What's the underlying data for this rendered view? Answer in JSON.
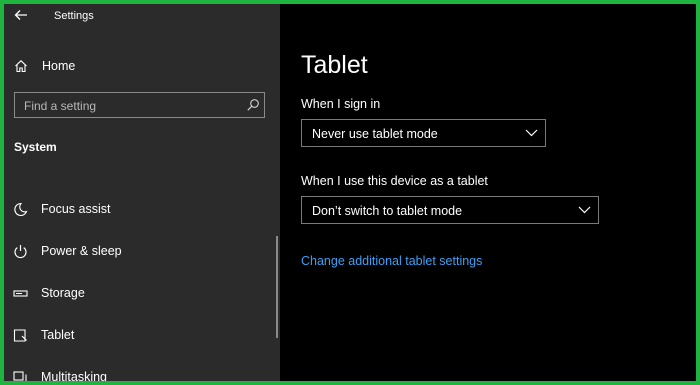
{
  "window": {
    "title": "Settings"
  },
  "sidebar": {
    "home_label": "Home",
    "search_placeholder": "Find a setting",
    "section_title": "System",
    "items": [
      {
        "label": "Focus assist",
        "icon": "moon-icon"
      },
      {
        "label": "Power & sleep",
        "icon": "power-icon"
      },
      {
        "label": "Storage",
        "icon": "storage-icon"
      },
      {
        "label": "Tablet",
        "icon": "tablet-icon"
      },
      {
        "label": "Multitasking",
        "icon": "multitasking-icon"
      }
    ]
  },
  "main": {
    "title": "Tablet",
    "sign_in": {
      "label": "When I sign in",
      "value": "Never use tablet mode"
    },
    "use_as_tablet": {
      "label": "When I use this device as a tablet",
      "value": "Don’t switch to tablet mode"
    },
    "link_text": "Change additional tablet settings"
  },
  "colors": {
    "frame_border": "#1fb33f",
    "sidebar_bg": "#2b2b2b",
    "main_bg": "#000000",
    "link": "#3f9ff2"
  }
}
